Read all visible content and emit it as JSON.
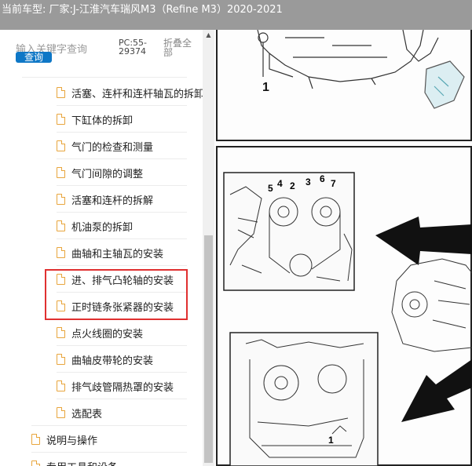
{
  "header": {
    "label": "当前车型:",
    "vehicle": "厂家:J-江淮汽车瑞风M3（Refine M3）2020-2021"
  },
  "search": {
    "placeholder": "输入关键字查询",
    "button_label": "查询",
    "pc_code": "PC:55-29374",
    "collapse_label": "折叠全部"
  },
  "tree": {
    "items": [
      {
        "label": "活塞、连杆和连杆轴瓦的拆卸"
      },
      {
        "label": "下缸体的拆卸"
      },
      {
        "label": "气门的检查和测量"
      },
      {
        "label": "气门间隙的调整"
      },
      {
        "label": "活塞和连杆的拆解"
      },
      {
        "label": "机油泵的拆卸"
      },
      {
        "label": "曲轴和主轴瓦的安装"
      },
      {
        "label": "进、排气凸轮轴的安装"
      },
      {
        "label": "正时链条张紧器的安装"
      },
      {
        "label": "点火线圈的安装"
      },
      {
        "label": "曲轴皮带轮的安装"
      },
      {
        "label": "排气歧管隔热罩的安装"
      },
      {
        "label": "选配表"
      },
      {
        "label": "说明与操作"
      },
      {
        "label": "专用工具和设备"
      }
    ]
  },
  "diagram": {
    "callouts_top": [
      "1"
    ],
    "callouts_middle": [
      "5",
      "4",
      "2",
      "3",
      "6",
      "7"
    ],
    "callouts_bottom": [
      "1"
    ]
  },
  "colors": {
    "accent": "#0e77c6",
    "folder_icon": "#e8a53c",
    "highlight": "#e03030",
    "topbar": "#9a9a9a"
  }
}
